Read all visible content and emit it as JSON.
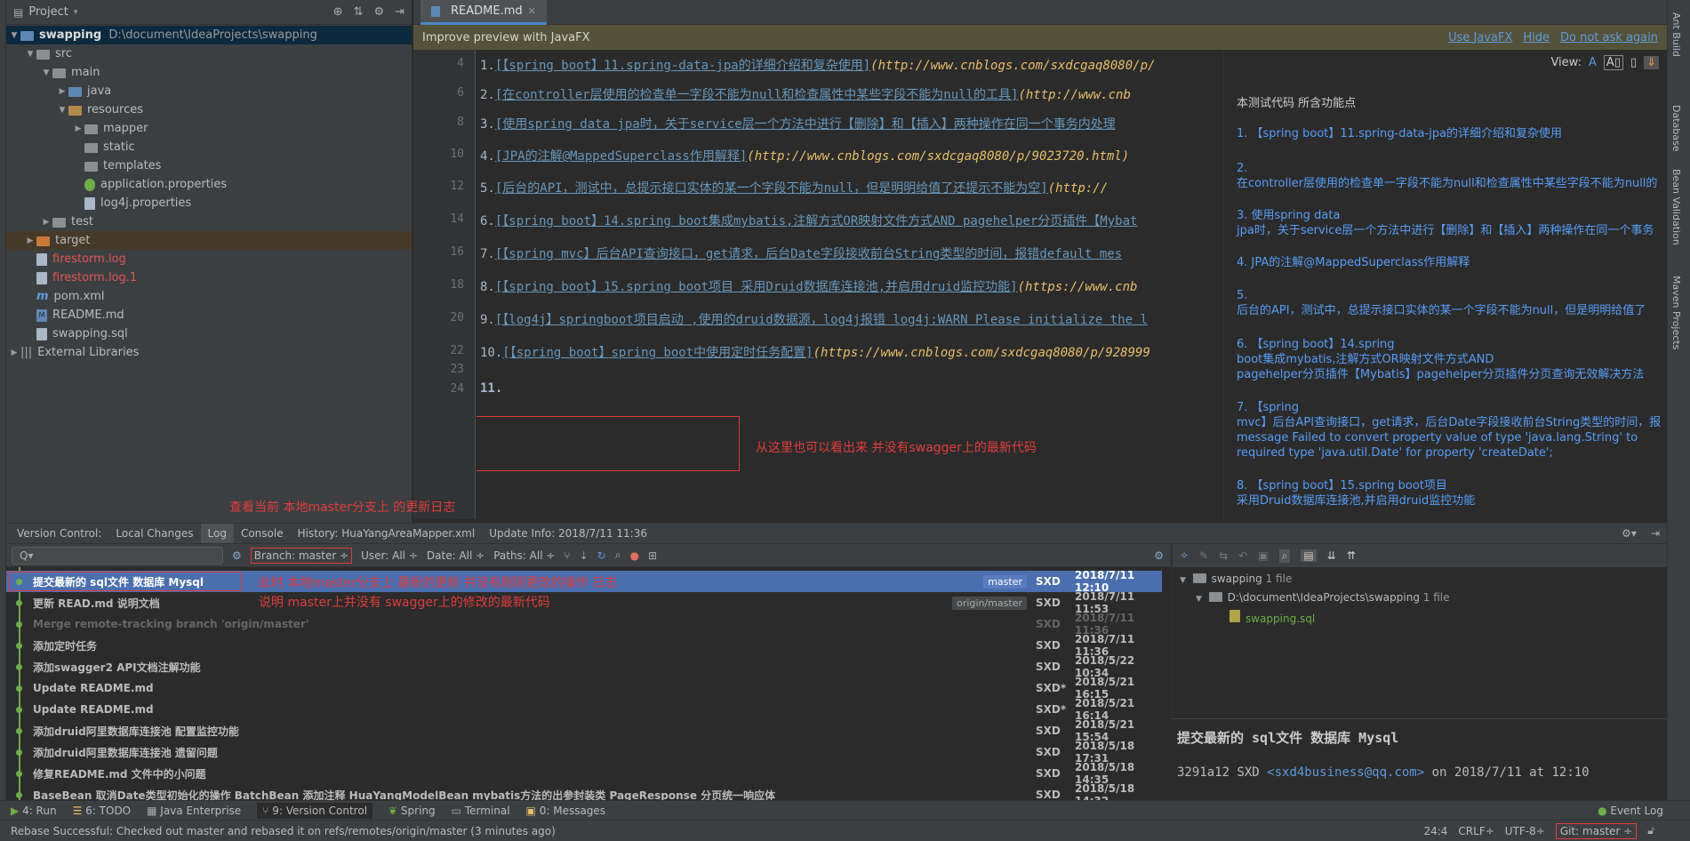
{
  "project": {
    "title": "Project",
    "tree": [
      {
        "label": "swapping",
        "path": "D:\\document\\IdeaProjects\\swapping"
      },
      {
        "label": "src"
      },
      {
        "label": "main"
      },
      {
        "label": "java"
      },
      {
        "label": "resources"
      },
      {
        "label": "mapper"
      },
      {
        "label": "static"
      },
      {
        "label": "templates"
      },
      {
        "label": "application.properties"
      },
      {
        "label": "log4j.properties"
      },
      {
        "label": "test"
      },
      {
        "label": "target"
      },
      {
        "label": "firestorm.log"
      },
      {
        "label": "firestorm.log.1"
      },
      {
        "label": "pom.xml"
      },
      {
        "label": "README.md"
      },
      {
        "label": "swapping.sql"
      },
      {
        "label": "External Libraries"
      }
    ]
  },
  "editor": {
    "tab": "README.md",
    "notify": {
      "text": "Improve preview with JavaFX",
      "use": "Use JavaFX",
      "hide": "Hide",
      "never": "Do not ask again"
    },
    "view_label": "View:",
    "line_numbers": [
      "4",
      "6",
      "8",
      "10",
      "12",
      "14",
      "16",
      "18",
      "20",
      "22",
      "23",
      "24"
    ],
    "lines": [
      {
        "num": "1.",
        "link": "[【spring boot】11.spring-data-jpa的详细介绍和复杂使用]",
        "url": "(http://www.cnblogs.com/sxdcgaq8080/p/"
      },
      {
        "num": "2.",
        "link": "[在controller层使用的检查单一字段不能为null和检查属性中某些字段不能为null的工具]",
        "url": "(http://www.cnb"
      },
      {
        "num": "3.",
        "link": "[使用spring data jpa时，关于service层一个方法中进行【删除】和【插入】两种操作在同一个事务内处理",
        "url": ""
      },
      {
        "num": "4.",
        "link": "[JPA的注解@MappedSuperclass作用解释]",
        "url": "(http://www.cnblogs.com/sxdcgaq8080/p/9023720.html)"
      },
      {
        "num": "5.",
        "link": "[后台的API，测试中，总提示接口实体的某一个字段不能为null，但是明明给值了还提示不能为空]",
        "url": "(http://"
      },
      {
        "num": "6.",
        "link": "[【spring boot】14.spring boot集成mybatis,注解方式OR映射文件方式AND pagehelper分页插件【Mybat",
        "url": ""
      },
      {
        "num": "7.",
        "link": "[【spring mvc】后台API查询接口，get请求，后台Date字段接收前台String类型的时间，报错default mes",
        "url": ""
      },
      {
        "num": "8.",
        "link": "[【spring boot】15.spring boot项目 采用Druid数据库连接池,并启用druid监控功能]",
        "url": "(https://www.cnb"
      },
      {
        "num": "9.",
        "link": "[【log4j】springboot项目启动 ,使用的druid数据源，log4j报错 log4j:WARN Please initialize the l",
        "url": ""
      },
      {
        "num": "10.",
        "link": "[【spring boot】spring boot中使用定时任务配置]",
        "url": "(https://www.cnblogs.com/sxdcgaq8080/p/928999"
      },
      {
        "num": "",
        "link": "",
        "url": ""
      },
      {
        "num": "11.",
        "link": "",
        "url": ""
      }
    ],
    "annotation": "从这里也可以看出来 并没有swagger上的最新代码"
  },
  "preview": {
    "heading": "本测试代码 所含功能点",
    "items": [
      [
        "1. 【spring boot】11.spring-data-jpa的详细介绍和复杂使用"
      ],
      [
        "2.",
        "在controller层使用的检查单一字段不能为null和检查属性中某些字段不能为null的"
      ],
      [
        "3. 使用spring data",
        "jpa时，关于service层一个方法中进行【删除】和【插入】两种操作在同一个事务"
      ],
      [
        "4. JPA的注解@MappedSuperclass作用解释"
      ],
      [
        "5.",
        "后台的API，测试中，总提示接口实体的某一个字段不能为null，但是明明给值了"
      ],
      [
        "6. 【spring boot】14.spring",
        "boot集成mybatis,注解方式OR映射文件方式AND",
        "pagehelper分页插件【Mybatis】pagehelper分页插件分页查询无效解决方法"
      ],
      [
        "7. 【spring",
        "mvc】后台API查询接口，get请求，后台Date字段接收前台String类型的时间，报",
        "message Failed to convert property value of type 'java.lang.String' to",
        "required type 'java.util.Date' for property 'createDate';"
      ],
      [
        "8. 【spring boot】15.spring boot项目",
        "采用Druid数据库连接池,并启用druid监控功能"
      ]
    ]
  },
  "right_tools": [
    "Ant Build",
    "Database",
    "Bean Validation",
    "Maven Projects"
  ],
  "vcs": {
    "annotation_top": "查看当前 本地master分支上  的更新日志",
    "tabs": [
      "Version Control:",
      "Local Changes",
      "Log",
      "Console",
      "History: HuaYangAreaMapper.xml",
      "Update Info: 2018/7/11 11:36"
    ],
    "search_placeholder": "Q▾",
    "branch": "Branch: master ÷",
    "user": "User: All ÷",
    "date": "Date: All ÷",
    "paths": "Paths: All ÷",
    "commits": [
      {
        "msg": "提交最新的 sql文件  数据库 Mysql",
        "tag": "master",
        "author": "SXD",
        "date": "2018/7/11 12:10"
      },
      {
        "msg": "更新 READ.md  说明文档",
        "tag": "origin/master",
        "author": "SXD",
        "date": "2018/7/11 11:53"
      },
      {
        "msg": "Merge remote-tracking branch 'origin/master'",
        "tag": "",
        "author": "SXD",
        "date": "2018/7/11 11:36"
      },
      {
        "msg": "添加定时任务",
        "tag": "",
        "author": "SXD",
        "date": "2018/7/11 11:36"
      },
      {
        "msg": "添加swagger2  API文档注解功能",
        "tag": "",
        "author": "SXD",
        "date": "2018/5/22 10:34"
      },
      {
        "msg": "Update README.md",
        "tag": "",
        "author": "SXD*",
        "date": "2018/5/21 16:15"
      },
      {
        "msg": "Update README.md",
        "tag": "",
        "author": "SXD*",
        "date": "2018/5/21 16:14"
      },
      {
        "msg": "添加druid阿里数据库连接池 配置监控功能",
        "tag": "",
        "author": "SXD",
        "date": "2018/5/21 15:54"
      },
      {
        "msg": "添加druid阿里数据库连接池 遗留问题",
        "tag": "",
        "author": "SXD",
        "date": "2018/5/18 17:31"
      },
      {
        "msg": "修复README.md 文件中的小问题",
        "tag": "",
        "author": "SXD",
        "date": "2018/5/18 14:35"
      },
      {
        "msg": "BaseBean 取消Date类型初始化的操作 BatchBean 添加注释 HuaYangModelBean mybatis方法的出参封装类 PageResponse  分页统一响应体",
        "tag": "",
        "author": "SXD",
        "date": "2018/5/18 14:32"
      }
    ],
    "annotation_row1": "此时  本地master分支上  最新的更新  并没有刚刚更改的操作  日志",
    "annotation_row2": "说明  master上并没有  swagger上的修改的最新代码",
    "files": {
      "root": "swapping",
      "root_count": "1 file",
      "dir": "D:\\document\\IdeaProjects\\swapping",
      "dir_count": "1 file",
      "file": "swapping.sql"
    },
    "detail_title": "提交最新的 sql文件  数据库 Mysql",
    "detail_hash": "3291a12 SXD",
    "detail_email": "<sxd4business@qq.com>",
    "detail_on": "on 2018/7/11 at 12:10"
  },
  "bottom_tools": [
    "4: Run",
    "6: TODO",
    "Java Enterprise",
    "9: Version Control",
    "Spring",
    "Terminal",
    "0: Messages",
    "Event Log"
  ],
  "status": {
    "message": "Rebase Successful: Checked out master and rebased it on refs/remotes/origin/master (3 minutes ago)",
    "pos": "24:4",
    "crlf": "CRLF÷",
    "enc": "UTF-8÷",
    "git": "Git: master ÷"
  }
}
